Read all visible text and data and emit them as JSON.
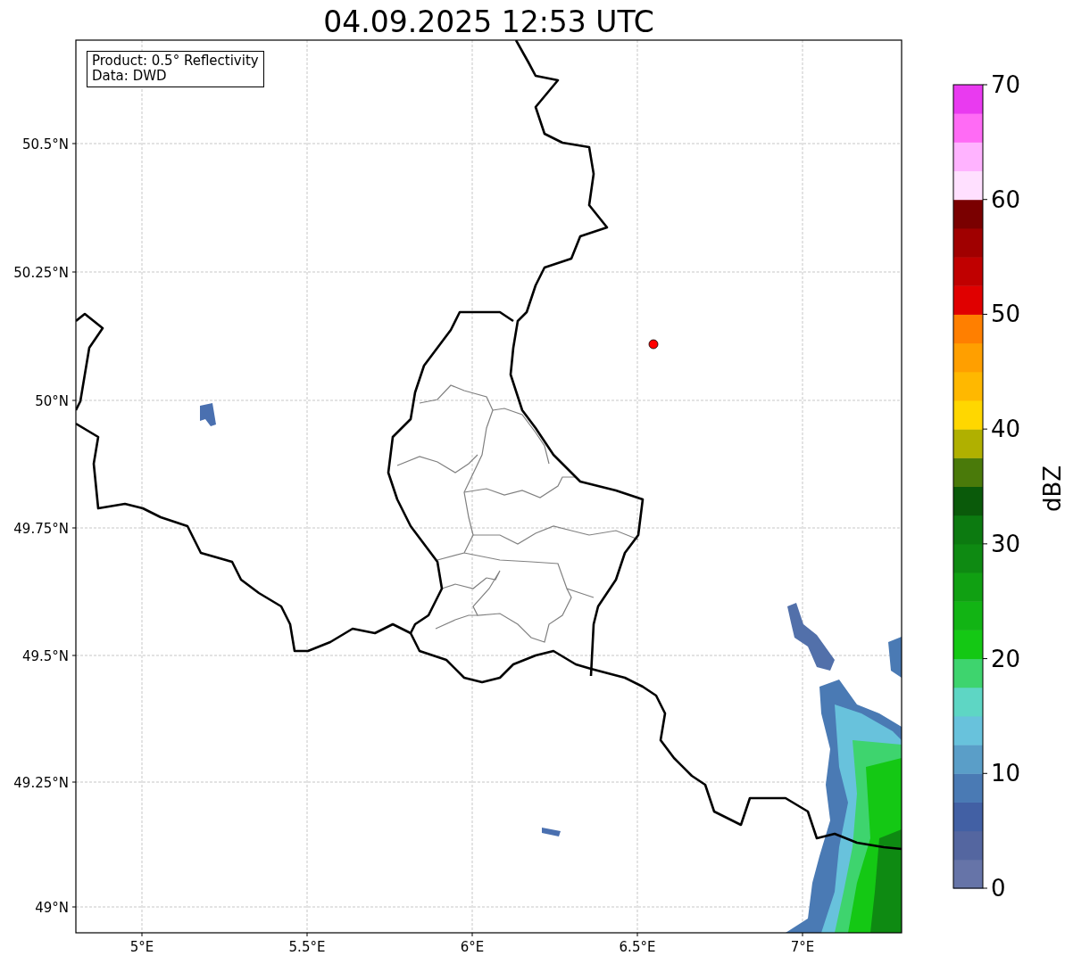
{
  "title": "04.09.2025 12:53 UTC",
  "info_box": [
    "Product: 0.5° Reflectivity",
    "Data: DWD"
  ],
  "map": {
    "xticks": [
      "5°E",
      "5.5°E",
      "6°E",
      "6.5°E",
      "7°E"
    ],
    "yticks": [
      "50.5°N",
      "50.25°N",
      "50°N",
      "49.75°N",
      "49.5°N",
      "49.25°N",
      "49°N"
    ]
  },
  "colorbar": {
    "label": "dBZ",
    "ticks": [
      "70",
      "60",
      "50",
      "40",
      "30",
      "20",
      "10",
      "0"
    ],
    "segments": [
      {
        "color": "#6674a8"
      },
      {
        "color": "#5466a0"
      },
      {
        "color": "#4260a4"
      },
      {
        "color": "#4a7ab4"
      },
      {
        "color": "#5a9ec8"
      },
      {
        "color": "#68c2dc"
      },
      {
        "color": "#5ed6c4"
      },
      {
        "color": "#3ed46e"
      },
      {
        "color": "#14c814"
      },
      {
        "color": "#12b414"
      },
      {
        "color": "#10a012"
      },
      {
        "color": "#0e8a12"
      },
      {
        "color": "#0c7a10"
      },
      {
        "color": "#0a5a0a"
      },
      {
        "color": "#4a7a0a"
      },
      {
        "color": "#b0b000"
      },
      {
        "color": "#ffd700"
      },
      {
        "color": "#ffb800"
      },
      {
        "color": "#ff9f00"
      },
      {
        "color": "#ff7f00"
      },
      {
        "color": "#e00000"
      },
      {
        "color": "#c00000"
      },
      {
        "color": "#a00000"
      },
      {
        "color": "#7a0000"
      },
      {
        "color": "#ffe0ff"
      },
      {
        "color": "#ffb3ff"
      },
      {
        "color": "#ff6bf5"
      },
      {
        "color": "#e93af0"
      }
    ]
  }
}
